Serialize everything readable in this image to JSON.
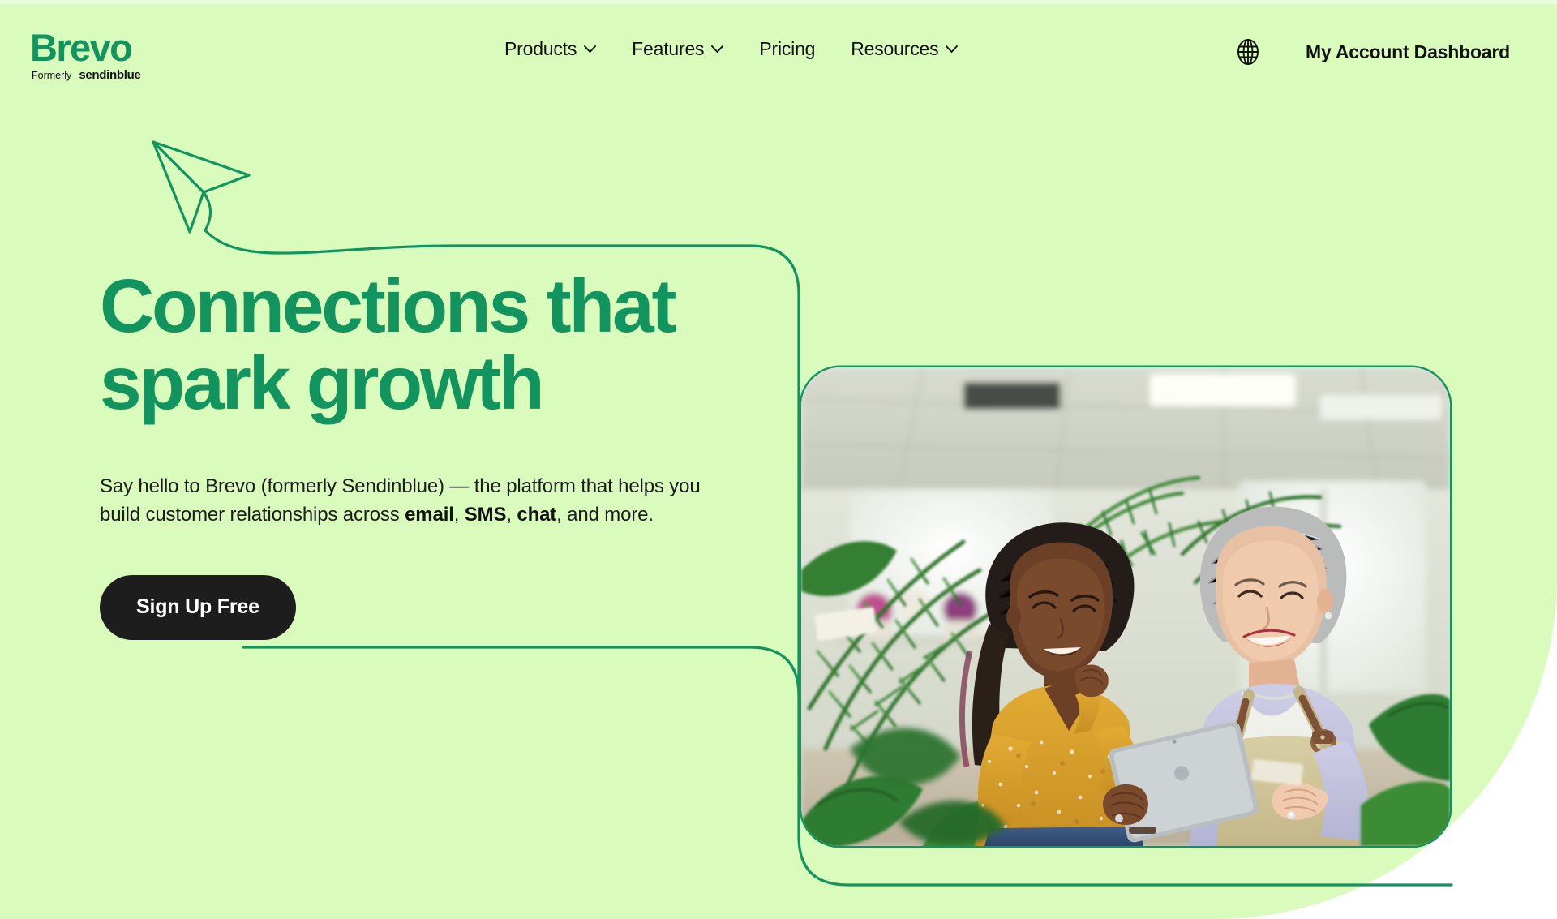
{
  "brand": {
    "name": "Brevo",
    "formerly_label": "Formerly",
    "formerly_name": "sendinblue",
    "green": "#12945E",
    "background": "#D9FCBD",
    "cta_background": "#1D1D1D",
    "text": "#111111"
  },
  "nav": {
    "items": [
      {
        "label": "Products",
        "icon": "chevron-down-icon",
        "has_dropdown": true
      },
      {
        "label": "Features",
        "icon": "chevron-down-icon",
        "has_dropdown": true
      },
      {
        "label": "Pricing",
        "icon": "",
        "has_dropdown": false
      },
      {
        "label": "Resources",
        "icon": "chevron-down-icon",
        "has_dropdown": true
      }
    ],
    "language_icon": "globe-icon",
    "account_label": "My Account Dashboard"
  },
  "hero": {
    "decoration_icon": "paper-plane-icon",
    "headline": "Connections that\nspark growth",
    "body": {
      "part1": "Say hello to Brevo (formerly Sendinblue) — the platform that helps you build customer relationships across ",
      "bold1": "email",
      "sep1": ", ",
      "bold2": "SMS",
      "sep2": ", ",
      "bold3": "chat",
      "part2": ", and more."
    },
    "cta_label": "Sign Up Free",
    "image_alt": "Two women in a plant shop looking at a tablet together"
  }
}
